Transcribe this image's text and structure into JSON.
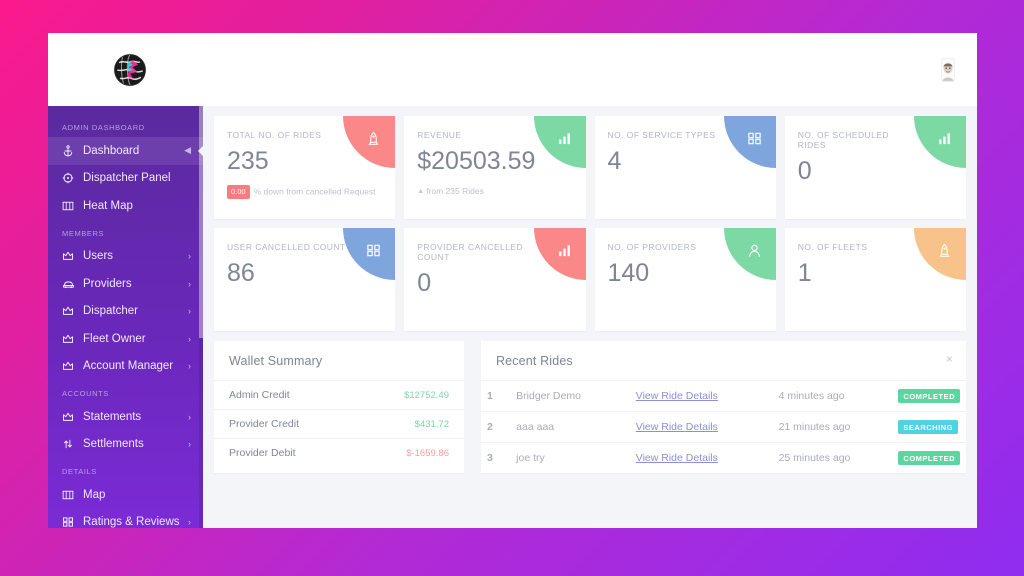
{
  "header": {
    "logo_alt": "globe-logo",
    "avatar_alt": "user-avatar"
  },
  "sidebar": {
    "sections": [
      {
        "label": "ADMIN DASHBOARD",
        "items": [
          {
            "label": "Dashboard",
            "icon": "anchor-icon",
            "active": true,
            "chevron": "◀"
          },
          {
            "label": "Dispatcher Panel",
            "icon": "compass-icon",
            "active": false,
            "chevron": ""
          },
          {
            "label": "Heat Map",
            "icon": "map-icon",
            "active": false,
            "chevron": ""
          }
        ]
      },
      {
        "label": "MEMBERS",
        "items": [
          {
            "label": "Users",
            "icon": "crown-icon",
            "active": false,
            "chevron": "›"
          },
          {
            "label": "Providers",
            "icon": "car-icon",
            "active": false,
            "chevron": "›"
          },
          {
            "label": "Dispatcher",
            "icon": "crown-icon",
            "active": false,
            "chevron": "›"
          },
          {
            "label": "Fleet Owner",
            "icon": "crown-icon",
            "active": false,
            "chevron": "›"
          },
          {
            "label": "Account Manager",
            "icon": "crown-icon",
            "active": false,
            "chevron": "›"
          }
        ]
      },
      {
        "label": "ACCOUNTS",
        "items": [
          {
            "label": "Statements",
            "icon": "crown-icon",
            "active": false,
            "chevron": "›"
          },
          {
            "label": "Settlements",
            "icon": "exchange-icon",
            "active": false,
            "chevron": "›"
          }
        ]
      },
      {
        "label": "DETAILS",
        "items": [
          {
            "label": "Map",
            "icon": "map-icon",
            "active": false,
            "chevron": ""
          },
          {
            "label": "Ratings & Reviews",
            "icon": "grid-icon",
            "active": false,
            "chevron": "›"
          }
        ]
      }
    ]
  },
  "stats": [
    {
      "title": "TOTAL NO. OF RIDES",
      "value": "235",
      "pill": "0.00",
      "foot": "% down from cancelled Request",
      "icon": "rocket-icon",
      "color": "#fb8888"
    },
    {
      "title": "REVENUE",
      "value": "$20503.59",
      "pill": "",
      "foot": "from 235 Rides",
      "icon": "bar-chart-icon",
      "color": "#7cd9a4"
    },
    {
      "title": "NO. OF SERVICE TYPES",
      "value": "4",
      "pill": "",
      "foot": "",
      "icon": "grid-icon",
      "color": "#7fa5dd"
    },
    {
      "title": "NO. OF SCHEDULED RIDES",
      "value": "0",
      "pill": "",
      "foot": "",
      "icon": "bar-chart-icon",
      "color": "#7cd9a4"
    },
    {
      "title": "USER CANCELLED COUNT",
      "value": "86",
      "pill": "",
      "foot": "",
      "icon": "grid-icon",
      "color": "#7fa5dd"
    },
    {
      "title": "PROVIDER CANCELLED COUNT",
      "value": "0",
      "pill": "",
      "foot": "",
      "icon": "bar-chart-icon",
      "color": "#fb8888"
    },
    {
      "title": "NO. OF PROVIDERS",
      "value": "140",
      "pill": "",
      "foot": "",
      "icon": "user-icon",
      "color": "#7cd9a4"
    },
    {
      "title": "NO. OF FLEETS",
      "value": "1",
      "pill": "",
      "foot": "",
      "icon": "rocket-icon",
      "color": "#f8c38a"
    }
  ],
  "wallet": {
    "title": "Wallet Summary",
    "rows": [
      {
        "label": "Admin Credit",
        "value": "$12752.49",
        "sign": "pos"
      },
      {
        "label": "Provider Credit",
        "value": "$431.72",
        "sign": "pos"
      },
      {
        "label": "Provider Debit",
        "value": "$-1659.86",
        "sign": "neg"
      }
    ]
  },
  "recent_rides": {
    "title": "Recent Rides",
    "close_icon": "×",
    "rows": [
      {
        "index": "1",
        "name": "Bridger Demo",
        "link": "View Ride Details",
        "time": "4 minutes ago",
        "status": "COMPLETED",
        "status_class": "completed"
      },
      {
        "index": "2",
        "name": "aaa aaa",
        "link": "View Ride Details",
        "time": "21 minutes ago",
        "status": "SEARCHING",
        "status_class": "searching"
      },
      {
        "index": "3",
        "name": "joe try",
        "link": "View Ride Details",
        "time": "25 minutes ago",
        "status": "COMPLETED",
        "status_class": "completed"
      }
    ]
  },
  "colors": {
    "bg_start": "#fa1a8c",
    "bg_end": "#8f2df0",
    "sidebar": "#6a28bb",
    "green": "#5cd6a0",
    "cyan": "#4fd2e2",
    "red": "#fb7b80"
  }
}
